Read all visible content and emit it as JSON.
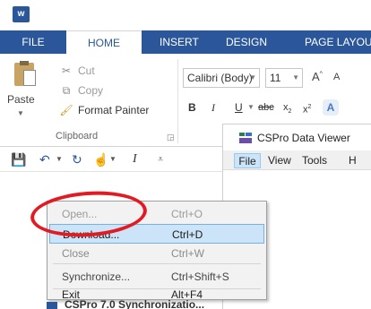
{
  "app": {
    "logo_letter": "w"
  },
  "ribbon": {
    "tabs": [
      {
        "label": "FILE"
      },
      {
        "label": "HOME"
      },
      {
        "label": "INSERT"
      },
      {
        "label": "DESIGN"
      },
      {
        "label": "PAGE LAYOU"
      }
    ],
    "clipboard": {
      "paste_label": "Paste",
      "cut_label": "Cut",
      "copy_label": "Copy",
      "format_painter_label": "Format Painter",
      "group_label": "Clipboard"
    },
    "font": {
      "name": "Calibri (Body)",
      "size": "11",
      "grow": "A",
      "shrink": "A",
      "bold": "B",
      "italic": "I",
      "underline": "U",
      "strikethrough": "abc",
      "subscript": "x",
      "superscript": "x",
      "effects": "A"
    }
  },
  "qat": {
    "italic_glyph": "I"
  },
  "cspro": {
    "title": "CSPro Data Viewer",
    "menus": [
      "File",
      "View",
      "Tools",
      "H"
    ]
  },
  "file_menu": {
    "items": [
      {
        "label": "Open...",
        "shortcut": "Ctrl+O",
        "enabled": false
      },
      {
        "label": "Download...",
        "shortcut": "Ctrl+D",
        "enabled": true,
        "highlighted": true
      },
      {
        "label": "Close",
        "shortcut": "Ctrl+W",
        "enabled": false
      },
      {
        "label": "Synchronize...",
        "shortcut": "Ctrl+Shift+S",
        "enabled": true
      },
      {
        "label": "Exit",
        "shortcut": "Alt+F4",
        "enabled": true
      }
    ],
    "highlight_color": "#e21b23"
  },
  "taskbar_item": {
    "label": "CSPro 7.0 Synchronizatio..."
  }
}
